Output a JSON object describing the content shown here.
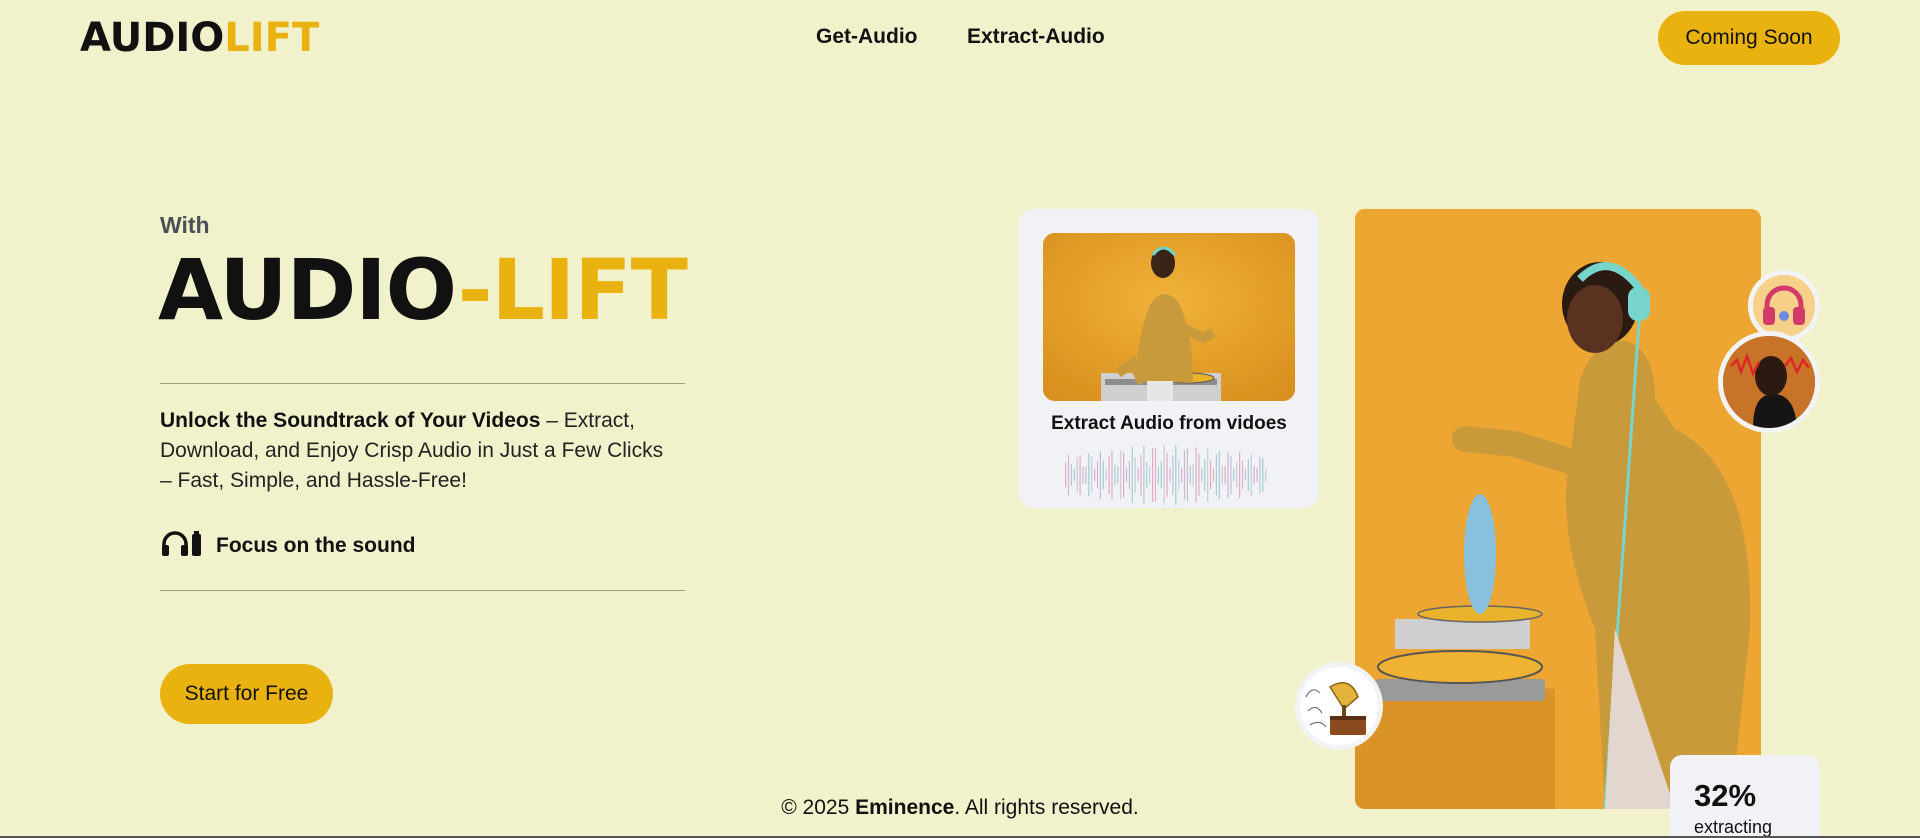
{
  "nav": {
    "logo_part1": "AUDIO",
    "logo_part2": "LIFT",
    "links": [
      {
        "label": "Get-Audio"
      },
      {
        "label": "Extract-Audio"
      }
    ],
    "cta_label": "Coming Soon"
  },
  "hero": {
    "eyebrow": "With",
    "title_part1": "AUDIO",
    "title_part2": "-LIFT",
    "desc_bold": "Unlock the Soundtrack of Your Videos",
    "desc_rest": " – Extract, Download, and Enjoy Crisp Audio in Just a Few Clicks – Fast, Simple, and Hassle-Free!",
    "focus_label": "Focus on the sound",
    "focus_icon": "headphones-battery-icon",
    "start_label": "Start for Free"
  },
  "card": {
    "title": "Extract Audio from vidoes"
  },
  "stats": {
    "percent": "32%",
    "label": "extracting"
  },
  "footer": {
    "prefix": "© 2025 ",
    "brand": "Eminence",
    "suffix": ". All rights reserved."
  },
  "colors": {
    "background": "#f1f2cc",
    "accent": "#e9b20e",
    "card_bg": "#f0f2f5"
  }
}
